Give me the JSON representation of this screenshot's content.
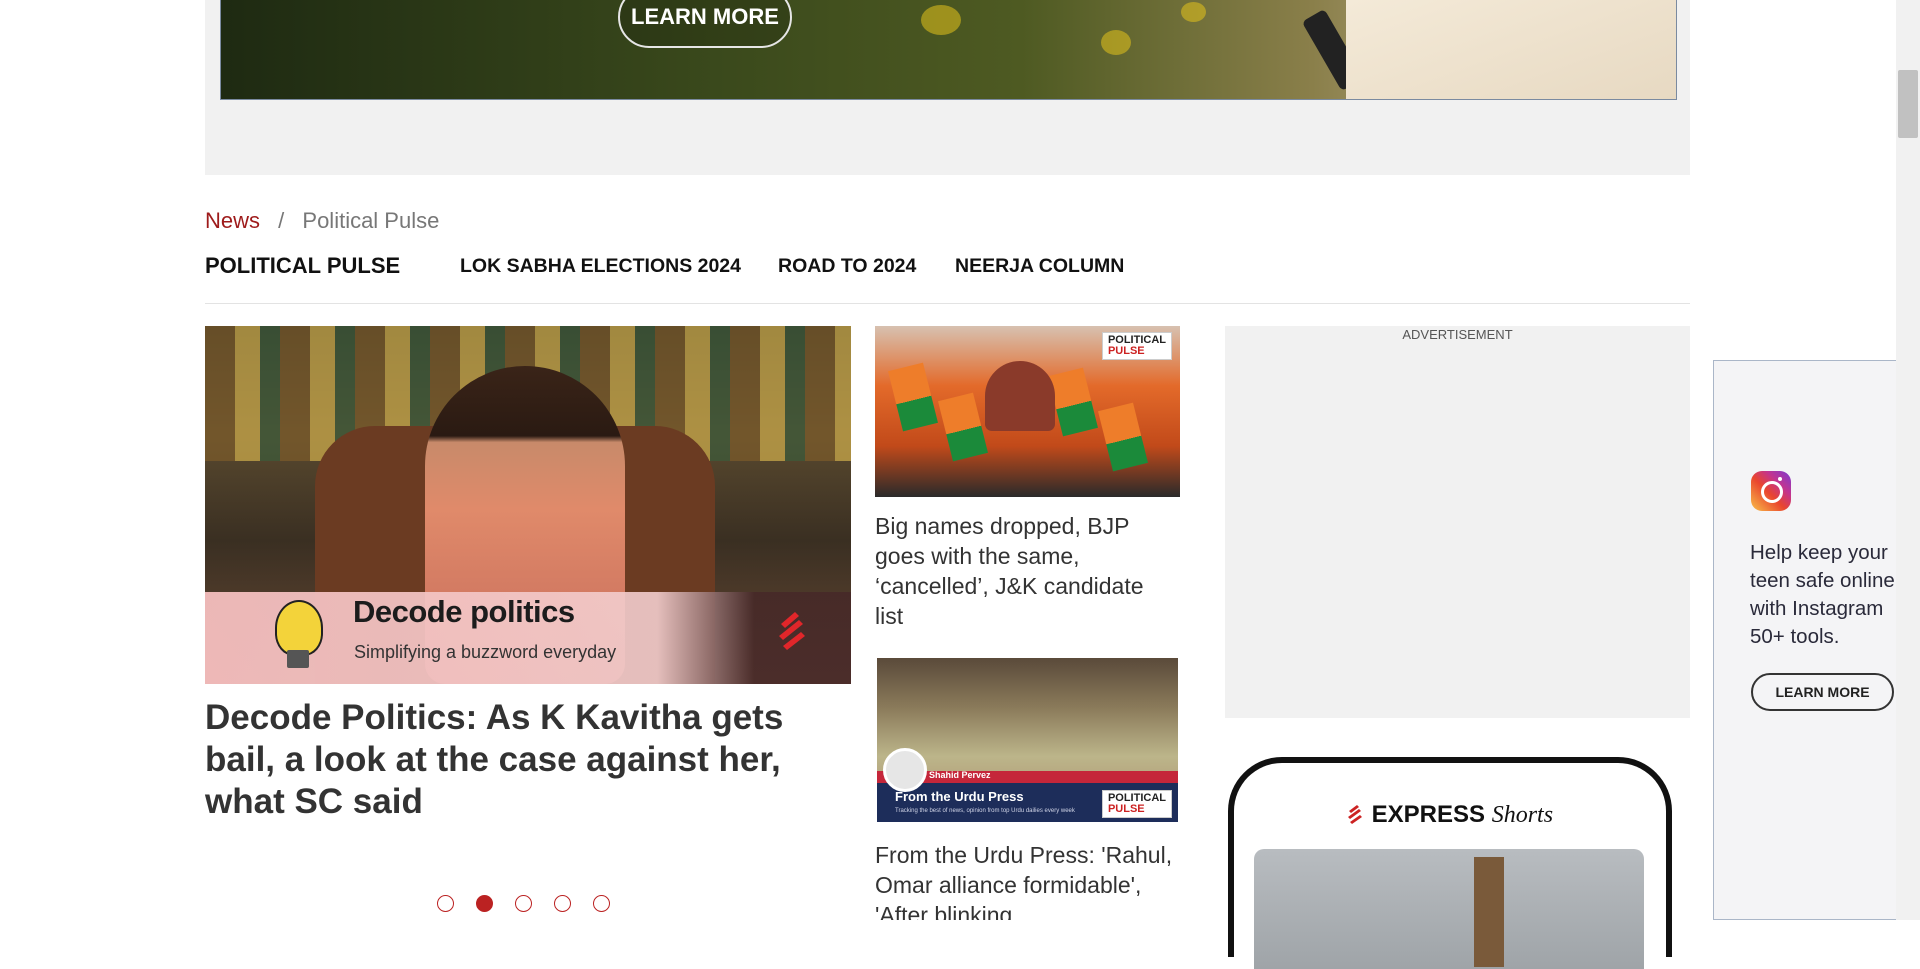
{
  "top_ad": {
    "cta": "LEARN MORE"
  },
  "breadcrumb": {
    "home": "News",
    "separator": "/",
    "current": "Political Pulse"
  },
  "section_nav": {
    "title": "POLITICAL PULSE",
    "items": [
      "LOK SABHA ELECTIONS 2024",
      "ROAD TO 2024",
      "NEERJA COLUMN"
    ]
  },
  "main_story": {
    "image_title": "Decode politics",
    "image_subtitle": "Simplifying a buzzword everyday",
    "headline": "Decode Politics: As K Kavitha gets bail, a look at the case against her, what SC said"
  },
  "carousel": {
    "count": 5,
    "active_index": 1
  },
  "cards": [
    {
      "badge_line1": "POLITICAL",
      "badge_line2": "PULSE",
      "headline": "Big names dropped, BJP goes with the same, ‘cancelled’, J&K candidate list"
    },
    {
      "author": "Shahid Pervez",
      "series": "From the Urdu Press",
      "series_sub": "Tracking the best of news, opinion from top Urdu dailies every week",
      "badge_line1": "POLITICAL",
      "badge_line2": "PULSE",
      "headline": "From the Urdu Press: 'Rahul, Omar alliance formidable', 'After blinking"
    }
  ],
  "right_ad": {
    "label": "ADVERTISEMENT"
  },
  "shorts": {
    "brand_bold": "EXPRESS",
    "brand_italic": "Shorts"
  },
  "instagram_ad": {
    "text_lines": [
      "Help keep your",
      "teen safe online",
      "with Instagram",
      "50+ tools."
    ],
    "cta": "LEARN MORE"
  },
  "colors": {
    "accent": "#9e1b1b",
    "dot": "#bb2222",
    "ad_bg": "#f1f1f1"
  }
}
